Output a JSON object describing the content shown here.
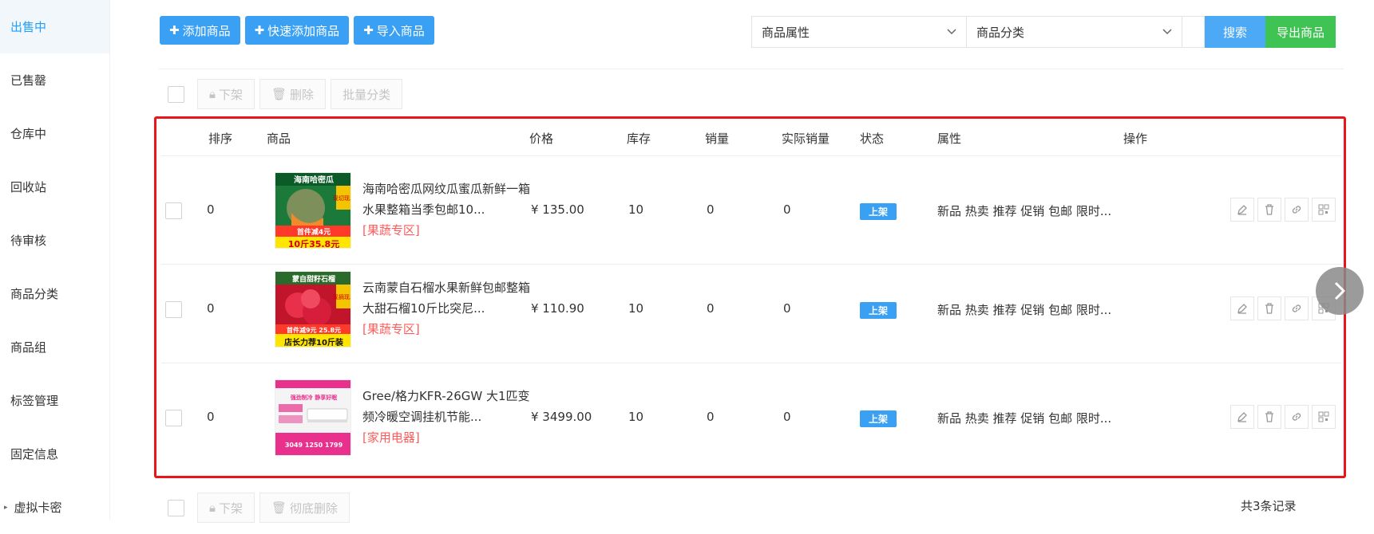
{
  "sidebar": {
    "items": [
      {
        "label": "出售中",
        "active": true
      },
      {
        "label": "已售罄"
      },
      {
        "label": "仓库中"
      },
      {
        "label": "回收站"
      },
      {
        "label": "待审核"
      },
      {
        "label": "商品分类"
      },
      {
        "label": "商品组"
      },
      {
        "label": "标签管理"
      },
      {
        "label": "固定信息"
      },
      {
        "label": "虚拟卡密"
      }
    ]
  },
  "toolbar": {
    "add_label": "添加商品",
    "quick_add_label": "快速添加商品",
    "import_label": "导入商品"
  },
  "filters": {
    "attr_placeholder": "商品属性",
    "category_placeholder": "商品分类",
    "search_label": "搜索",
    "export_label": "导出商品"
  },
  "bulk_top": {
    "offshelf_label": "下架",
    "delete_label": "删除",
    "batch_category_label": "批量分类"
  },
  "table": {
    "headers": {
      "sort": "排序",
      "product": "商品",
      "price": "价格",
      "stock": "库存",
      "sales": "销量",
      "actual_sales": "实际销量",
      "status": "状态",
      "attrs": "属性",
      "ops": "操作"
    },
    "rows": [
      {
        "sort": "0",
        "name": "海南哈密瓜网纹瓜蜜瓜新鲜一箱水果整箱当季包邮10...",
        "category": "[果蔬专区]",
        "price": "¥ 135.00",
        "stock": "10",
        "sales": "0",
        "actual_sales": "0",
        "status": "上架",
        "attrs": "新品 热卖 推荐 促销 包邮 限时...",
        "thumb": {
          "title": "海南哈密瓜",
          "promo": "首件减4元",
          "badge": "10斤35.8元",
          "side": "现切现发",
          "bg": "#1b7a3a",
          "accent": "#ffe600"
        }
      },
      {
        "sort": "0",
        "name": "云南蒙自石榴水果新鲜包邮整箱大甜石榴10斤比突尼...",
        "category": "[果蔬专区]",
        "price": "¥ 110.90",
        "stock": "10",
        "sales": "0",
        "actual_sales": "0",
        "status": "上架",
        "attrs": "新品 热卖 推荐 促销 包邮 限时...",
        "thumb": {
          "title": "蒙自甜籽石榴",
          "promo": "首件减9元 25.8元",
          "badge": "店长力荐10斤装",
          "side": "现摘现发",
          "bg": "#c0152b",
          "accent": "#ffe600"
        }
      },
      {
        "sort": "0",
        "name": "Gree/格力KFR-26GW 大1匹变频冷暖空调挂机节能...",
        "category": "[家用电器]",
        "price": "¥ 3499.00",
        "stock": "10",
        "sales": "0",
        "actual_sales": "0",
        "status": "上架",
        "attrs": "新品 热卖 推荐 促销 包邮 限时...",
        "thumb": {
          "title": "强劲制冷 静享好眠",
          "promo": "3049 1250 1799",
          "badge": "",
          "side": "",
          "bg": "#f2f2f2",
          "accent": "#e8308c"
        }
      }
    ]
  },
  "bulk_bottom": {
    "offshelf_label": "下架",
    "hard_delete_label": "彻底删除"
  },
  "footer": {
    "count_text": "共3条记录"
  },
  "colors": {
    "primary": "#3aa0f3",
    "export_green": "#3fc454",
    "highlight_border": "#e8161b",
    "category_red": "#ff5a5a"
  }
}
